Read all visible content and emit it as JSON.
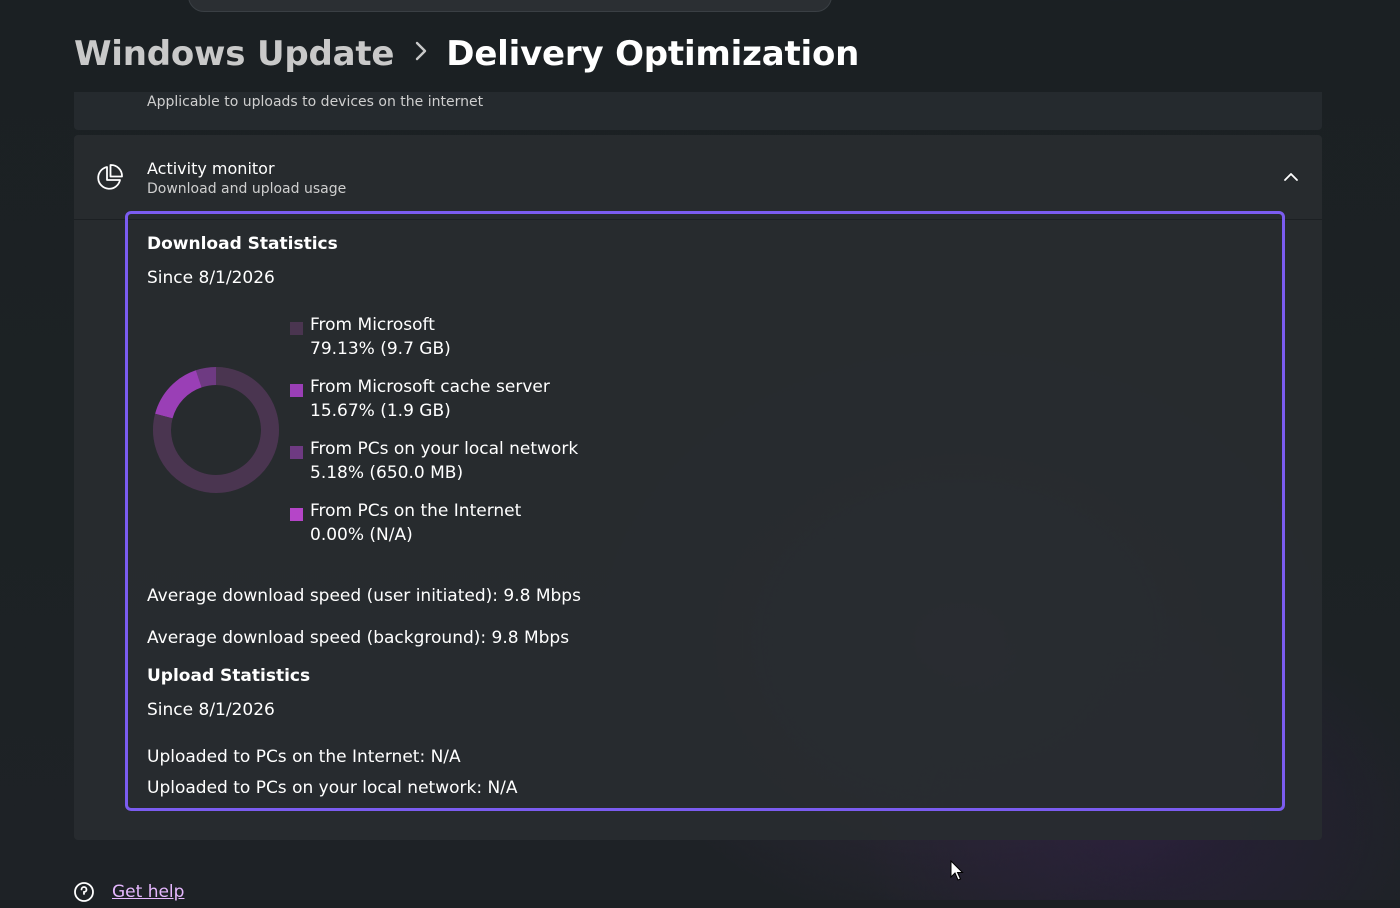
{
  "breadcrumb": {
    "parent": "Windows Update",
    "separator": ">",
    "current": "Delivery Optimization"
  },
  "upload_card": {
    "subtitle": "Applicable to uploads to devices on the internet"
  },
  "activity_monitor": {
    "title": "Activity monitor",
    "description": "Download and upload usage",
    "expanded": true,
    "icon": "pie-chart-icon",
    "chevron_icon": "chevron-up-icon"
  },
  "download_stats": {
    "heading": "Download Statistics",
    "since": "Since 8/1/2026",
    "sources": [
      {
        "label": "From Microsoft",
        "percent": "79.13%",
        "size": "(9.7 GB)",
        "value": 79.13,
        "color": "#4a3550"
      },
      {
        "label": "From Microsoft cache server",
        "percent": "15.67%",
        "size": "(1.9 GB)",
        "value": 15.67,
        "color": "#9a3fb6"
      },
      {
        "label": "From PCs on your local network",
        "percent": "5.18%",
        "size": "(650.0 MB)",
        "value": 5.18,
        "color": "#6e3a82"
      },
      {
        "label": "From PCs on the Internet",
        "percent": "0.00%",
        "size": "(N/A)",
        "value": 0.0,
        "color": "#b545c8"
      }
    ],
    "avg_user_initiated_label": "Average download speed (user initiated):",
    "avg_user_initiated_value": "9.8 Mbps",
    "avg_background_label": "Average download speed (background):",
    "avg_background_value": "9.8 Mbps"
  },
  "upload_stats": {
    "heading": "Upload Statistics",
    "since": "Since 8/1/2026",
    "internet": "Uploaded to PCs on the Internet: N/A",
    "local": "Uploaded to PCs on your local network: N/A"
  },
  "help": {
    "label": "Get help",
    "icon": "help-icon"
  },
  "colors": {
    "focus_border": "#7b5cf0",
    "link": "#e6b8ff",
    "card_bg": "#282c30"
  }
}
